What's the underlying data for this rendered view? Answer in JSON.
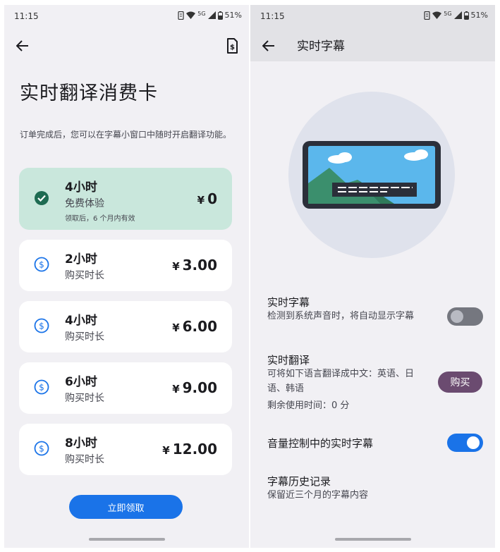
{
  "left": {
    "status": {
      "time": "11:15",
      "network": "5G",
      "battery": "51%"
    },
    "page_title": "实时翻译消费卡",
    "description": "订单完成后，您可以在字幕小窗口中随时开启翻译功能。",
    "currency": "¥",
    "cards": [
      {
        "name": "4小时",
        "sub": "免费体验",
        "note": "领取后，6 个月内有效",
        "price": "0",
        "selected": true
      },
      {
        "name": "2小时",
        "sub": "购买时长",
        "price": "3.00",
        "selected": false
      },
      {
        "name": "4小时",
        "sub": "购买时长",
        "price": "6.00",
        "selected": false
      },
      {
        "name": "6小时",
        "sub": "购买时长",
        "price": "9.00",
        "selected": false
      },
      {
        "name": "8小时",
        "sub": "购买时长",
        "price": "12.00",
        "selected": false
      }
    ],
    "claim_label": "立即领取"
  },
  "right": {
    "status": {
      "time": "11:15",
      "network": "5G",
      "battery": "51%"
    },
    "appbar_title": "实时字幕",
    "settings": {
      "live_caption": {
        "title": "实时字幕",
        "subtitle": "检测到系统声音时，将自动显示字幕",
        "enabled": false
      },
      "live_translate": {
        "title": "实时翻译",
        "subtitle": "可将如下语言翻译成中文：英语、日语、韩语",
        "remaining": "剩余使用时间：0 分",
        "buy_label": "购买"
      },
      "volume_caption": {
        "title": "音量控制中的实时字幕",
        "enabled": true
      },
      "history": {
        "title": "字幕历史记录",
        "subtitle": "保留近三个月的字幕内容"
      }
    }
  },
  "colors": {
    "selected_card": "#c9e7dc",
    "accent_blue": "#1a73e8",
    "check_green": "#1e6b52",
    "buy_purple": "#6b4b70"
  }
}
